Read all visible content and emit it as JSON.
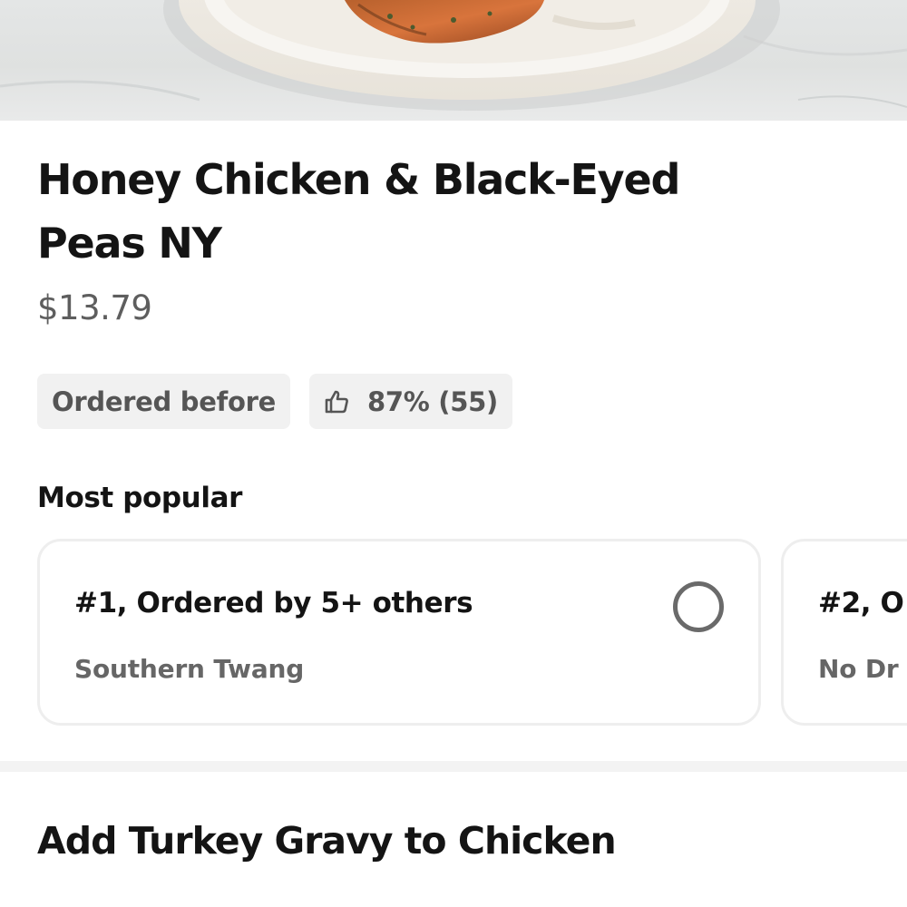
{
  "hero": {
    "image_alt": "Honey chicken on a white plate"
  },
  "item": {
    "title": "Honey Chicken & Black-Eyed Peas NY",
    "price": "$13.79"
  },
  "badges": {
    "ordered_before": "Ordered before",
    "rating": "87% (55)",
    "rating_icon": "thumbs-up-icon"
  },
  "most_popular": {
    "heading": "Most popular",
    "cards": [
      {
        "title": "#1, Ordered by 5+ others",
        "subtitle": "Southern Twang",
        "selected": false
      },
      {
        "title": "#2, O",
        "subtitle": "No Dr",
        "selected": false
      }
    ]
  },
  "addon": {
    "heading": "Add Turkey Gravy to Chicken"
  },
  "colors": {
    "text_primary": "#141414",
    "text_secondary": "#5e5e5e",
    "badge_bg": "#f1f1f1",
    "card_border": "#eeeeee",
    "radio": "#6a6a6a"
  }
}
